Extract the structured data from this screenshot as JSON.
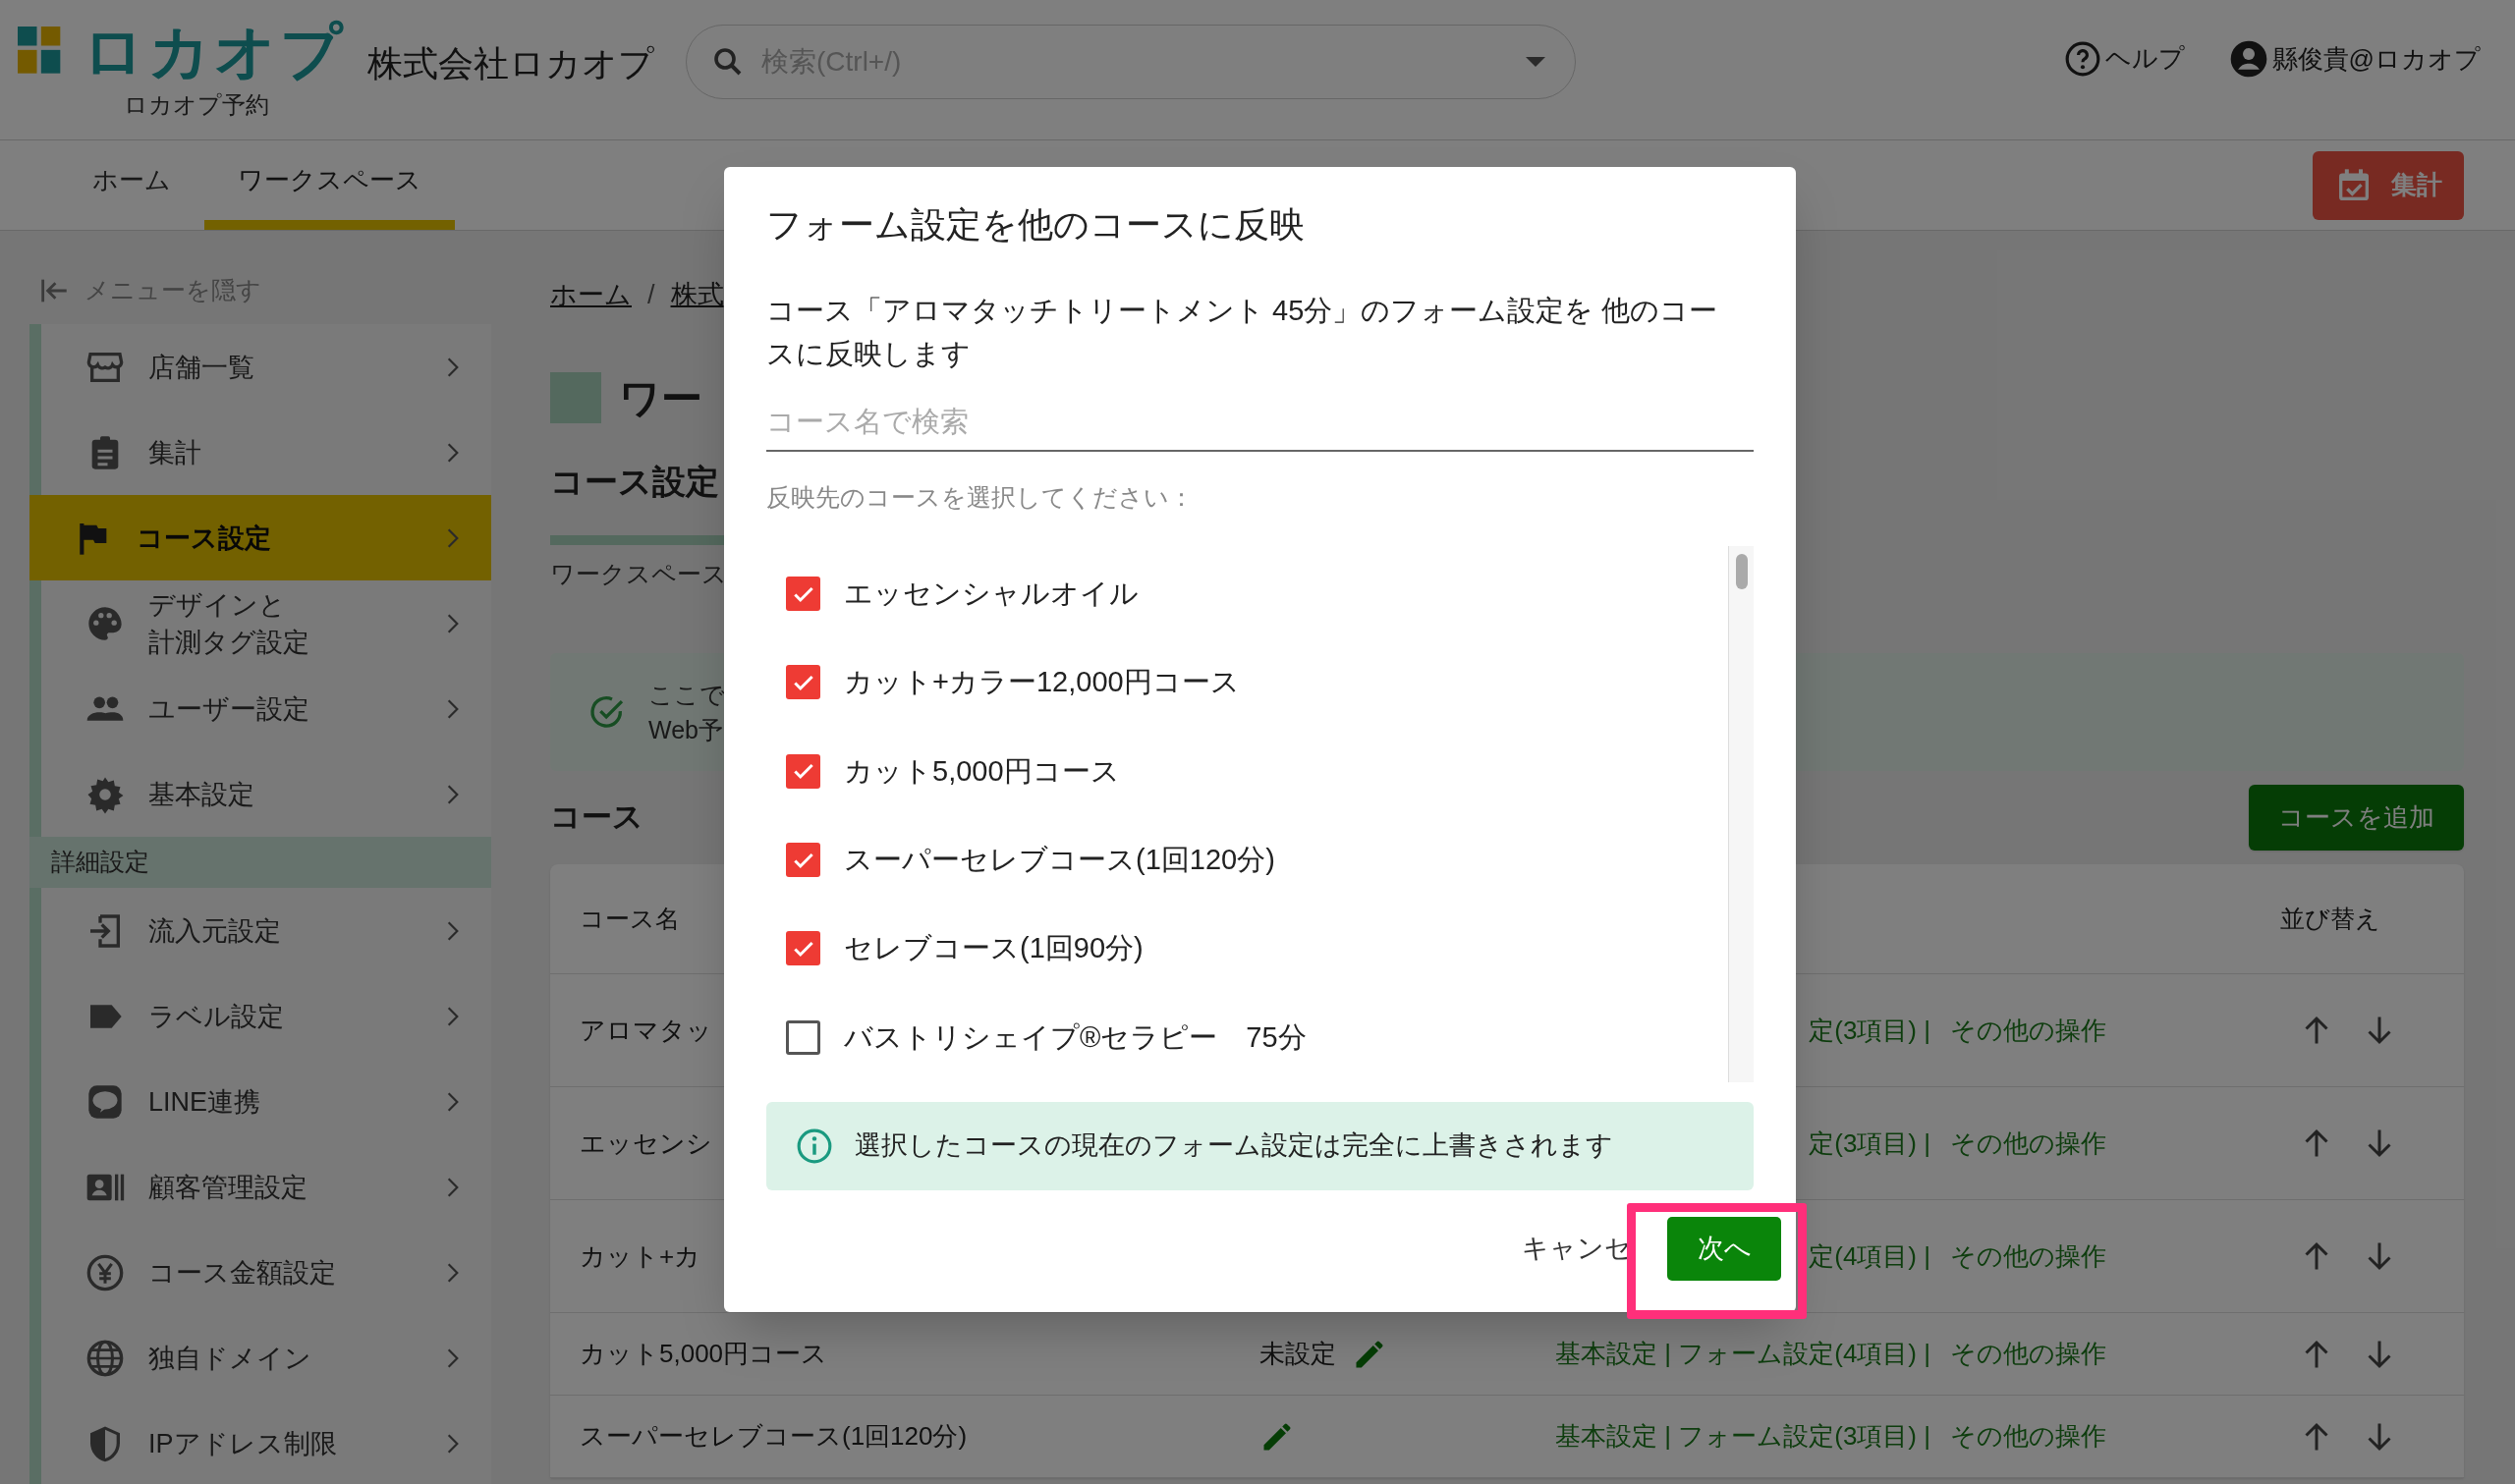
{
  "header": {
    "logo": "ロカオプ",
    "subtitle": "ロカオプ予約",
    "company": "株式会社ロカオプ",
    "search": {
      "placeholder": "検索(Ctrl+/)"
    },
    "help": "ヘルプ",
    "user": "縣俊貴@ロカオプ"
  },
  "tabs": [
    {
      "label": "ホーム",
      "selected": false
    },
    {
      "label": "ワークスペース",
      "selected": true
    }
  ],
  "tally_button": "集計",
  "sidebar": {
    "hide_label": "メニューを隠す",
    "items": [
      {
        "label": "店舗一覧",
        "selected": false
      },
      {
        "label": "集計",
        "selected": false
      },
      {
        "label": "コース設定",
        "selected": true
      },
      {
        "lines": [
          "デザインと",
          "計測タグ設定"
        ],
        "selected": false
      },
      {
        "label": "ユーザー設定",
        "selected": false
      },
      {
        "label": "基本設定",
        "selected": false
      }
    ],
    "section": "詳細設定",
    "section_items": [
      {
        "label": "流入元設定",
        "selected": false
      },
      {
        "label": "ラベル設定",
        "selected": false
      },
      {
        "label": "LINE連携",
        "selected": false
      },
      {
        "label": "顧客管理設定",
        "selected": false
      },
      {
        "label": "コース金額設定",
        "selected": false
      },
      {
        "label": "独自ドメイン",
        "selected": false
      },
      {
        "label": "IPアドレス制限",
        "selected": false
      }
    ]
  },
  "main": {
    "breadcrumb": [
      "ホーム",
      "株式"
    ],
    "breadcrumb_separator": "/",
    "title": "ワー",
    "section_title": "コース設定",
    "workspace_label": "ワークスペース",
    "info_lines": [
      "ここで",
      "Web予"
    ],
    "courses_heading": "コース",
    "add_button": "コースを追加",
    "table": {
      "columns": [
        "コース名",
        "並び替え"
      ],
      "rows": [
        {
          "name": "アロマタッ",
          "links": "定(3項目) |",
          "more": "その他の操作"
        },
        {
          "name": "エッセンシ",
          "links": "定(3項目) |",
          "more": "その他の操作"
        },
        {
          "name": "カット+カ",
          "links": "定(4項目) |",
          "more": "その他の操作"
        },
        {
          "name": "カット5,000円コース",
          "price": "未設定",
          "edit_icon": true,
          "links": "基本設定 | フォーム設定(4項目) |",
          "more": "その他の操作"
        },
        {
          "name": "スーパーセレブコース(1回120分)",
          "edit_icon": true,
          "links": "基本設定 | フォーム設定(3項目) |",
          "more": "その他の操作"
        }
      ]
    }
  },
  "dialog": {
    "title": "フォーム設定を他のコースに反映",
    "description": "コース「アロマタッチトリートメント 45分」のフォーム設定を 他のコースに反映します",
    "search": {
      "placeholder": "コース名で検索"
    },
    "prompt": "反映先のコースを選択してください：",
    "courses": [
      {
        "label": "エッセンシャルオイル",
        "checked": true
      },
      {
        "label": "カット+カラー12,000円コース",
        "checked": true
      },
      {
        "label": "カット5,000円コース",
        "checked": true
      },
      {
        "label": "スーパーセレブコース(1回120分)",
        "checked": true
      },
      {
        "label": "セレブコース(1回90分)",
        "checked": true
      },
      {
        "label": "バストリシェイプ®セラピー　75分",
        "checked": false
      }
    ],
    "notice": "選択したコースの現在のフォーム設定は完全に上書きされます",
    "cancel": "キャンセ",
    "next": "次へ",
    "highlight": true
  }
}
